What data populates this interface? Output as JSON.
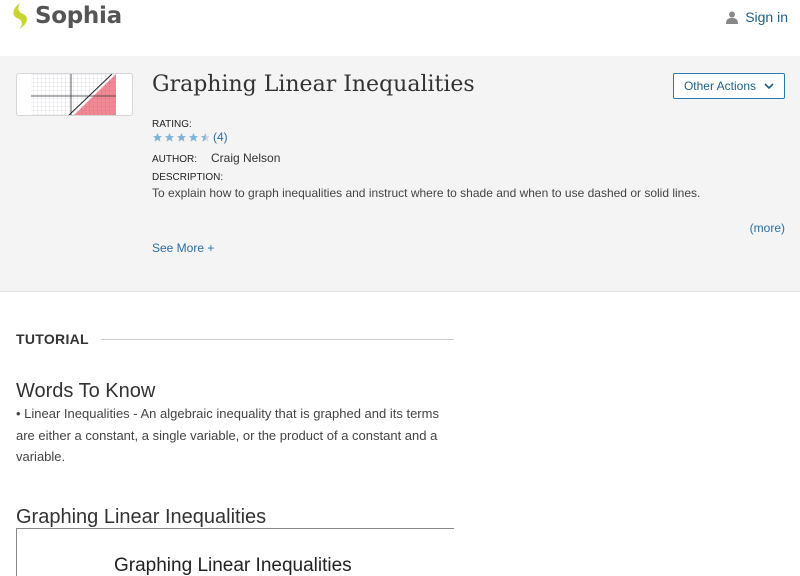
{
  "header": {
    "logo_text": "Sophia",
    "signin_label": "Sign in"
  },
  "resource": {
    "title": "Graphing Linear Inequalities",
    "other_actions_label": "Other Actions",
    "rating_label": "RATING:",
    "rating_value": 4.5,
    "rating_count": "(4)",
    "author_label": "AUTHOR:",
    "author_name": "Craig Nelson",
    "description_label": "DESCRIPTION:",
    "description_text": "To explain how to graph inequalities and instruct where to shade and when to use dashed or solid lines.",
    "more_link": "(more)",
    "see_more_label": "See More +"
  },
  "tutorial": {
    "label": "TUTORIAL",
    "words_heading": "Words To Know",
    "words_body": "• Linear Inequalities - An algebraic inequality that is graphed and its terms are either a constant, a single variable, or the product of a constant and a variable.",
    "graphing_heading": "Graphing Linear Inequalities",
    "embed_title": "Graphing Linear Inequalities"
  },
  "colors": {
    "accent": "#2a6ea8",
    "logo_green": "#c7d531",
    "hero_bg": "#f4f4f4"
  },
  "icons": {
    "logo": "sophia-leaf-icon",
    "user": "user-icon",
    "dropdown": "chevron-down-icon",
    "star": "star-icon"
  }
}
